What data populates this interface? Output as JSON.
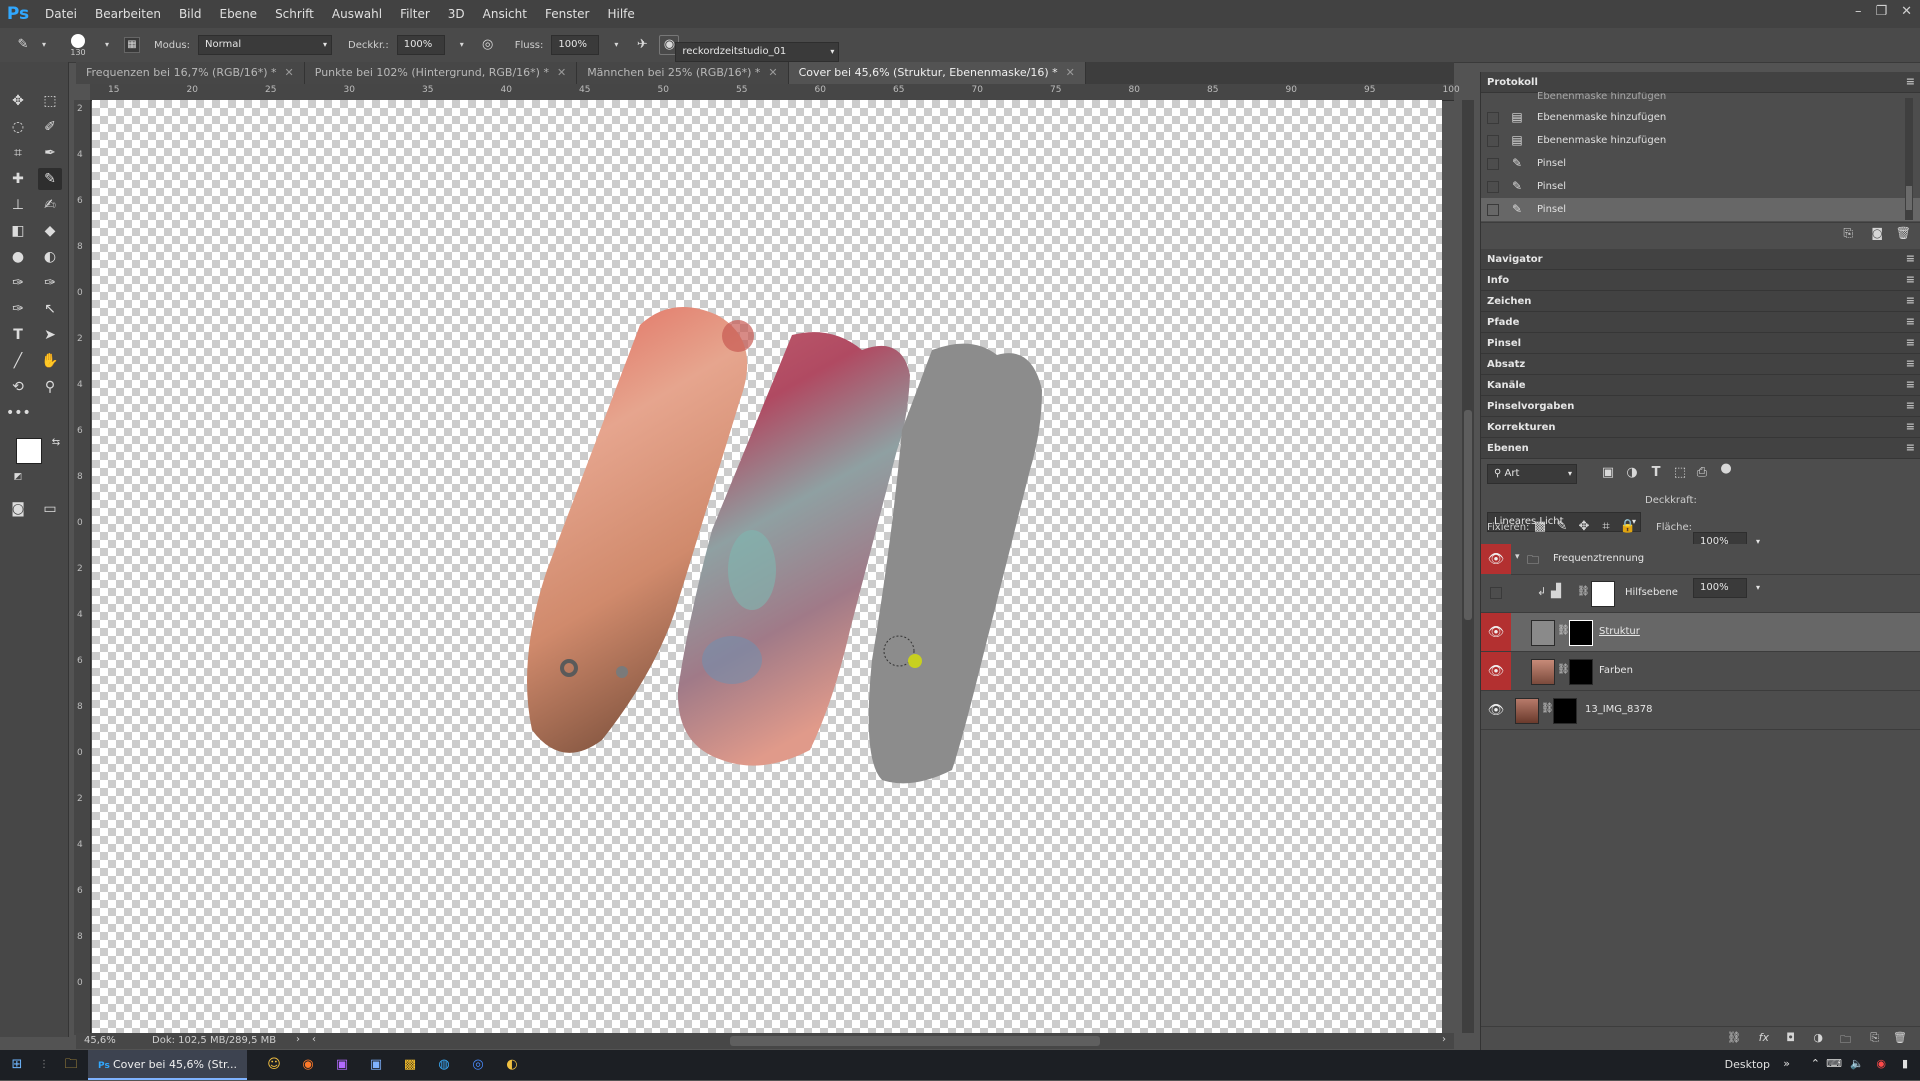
{
  "app": {
    "logo": "Ps"
  },
  "menu": [
    "Datei",
    "Bearbeiten",
    "Bild",
    "Ebene",
    "Schrift",
    "Auswahl",
    "Filter",
    "3D",
    "Ansicht",
    "Fenster",
    "Hilfe"
  ],
  "window_controls": [
    "–",
    "❐",
    "✕"
  ],
  "options": {
    "brush_size": "130",
    "mode_label": "Modus:",
    "mode_value": "Normal",
    "opacity_label": "Deckkr.:",
    "opacity_value": "100%",
    "flow_label": "Fluss:",
    "flow_value": "100%",
    "workspace": "reckordzeitstudio_01"
  },
  "tabs": [
    {
      "label": "Frequenzen bei 16,7% (RGB/16*) *",
      "active": false
    },
    {
      "label": "Punkte bei 102% (Hintergrund, RGB/16*) *",
      "active": false
    },
    {
      "label": "Männchen bei 25% (RGB/16*) *",
      "active": false
    },
    {
      "label": "Cover bei 45,6% (Struktur, Ebenenmaske/16) *",
      "active": true
    }
  ],
  "ruler_top": [
    "15",
    "20",
    "25",
    "30",
    "35",
    "40",
    "45",
    "50",
    "55",
    "60",
    "65",
    "70",
    "75",
    "80",
    "85",
    "90",
    "95",
    "100"
  ],
  "ruler_left": [
    "2",
    "4",
    "6",
    "8",
    "0",
    "2",
    "4",
    "6",
    "8",
    "0",
    "2",
    "4",
    "6",
    "8",
    "0",
    "2",
    "4",
    "6",
    "8",
    "0"
  ],
  "status": {
    "zoom": "45,6%",
    "doc": "Dok: 102,5 MB/289,5 MB"
  },
  "history": {
    "title": "Protokoll",
    "partial": "Ebenenmaske hinzufügen",
    "items": [
      {
        "label": "Ebenenmaske hinzufügen",
        "icon": "document-icon"
      },
      {
        "label": "Ebenenmaske hinzufügen",
        "icon": "document-icon"
      },
      {
        "label": "Pinsel",
        "icon": "brush-icon"
      },
      {
        "label": "Pinsel",
        "icon": "brush-icon"
      },
      {
        "label": "Pinsel",
        "icon": "brush-icon"
      }
    ]
  },
  "collapsed_panels": [
    "Navigator",
    "Info",
    "Zeichen",
    "Pfade",
    "Pinsel",
    "Absatz",
    "Kanäle",
    "Pinselvorgaben",
    "Korrekturen"
  ],
  "layers_panel": {
    "title": "Ebenen",
    "filter": "Art",
    "blend": "Lineares Licht",
    "opacity_label": "Deckkraft:",
    "opacity": "100%",
    "lock_label": "Fixieren:",
    "fill_label": "Fläche:",
    "fill": "100%",
    "group": "Frequenztrennung",
    "layers": [
      {
        "name": "Hilfsebene",
        "visible": false
      },
      {
        "name": "Struktur",
        "visible": true,
        "selected": true
      },
      {
        "name": "Farben",
        "visible": true
      },
      {
        "name": "13_IMG_8378",
        "visible": true
      }
    ]
  },
  "taskbar": {
    "task": "Cover bei 45,6% (Str...",
    "desktop": "Desktop"
  },
  "colors": {
    "accent": "#31a8ff",
    "eye_on": "#b33030",
    "selected_layer": "#676767"
  }
}
